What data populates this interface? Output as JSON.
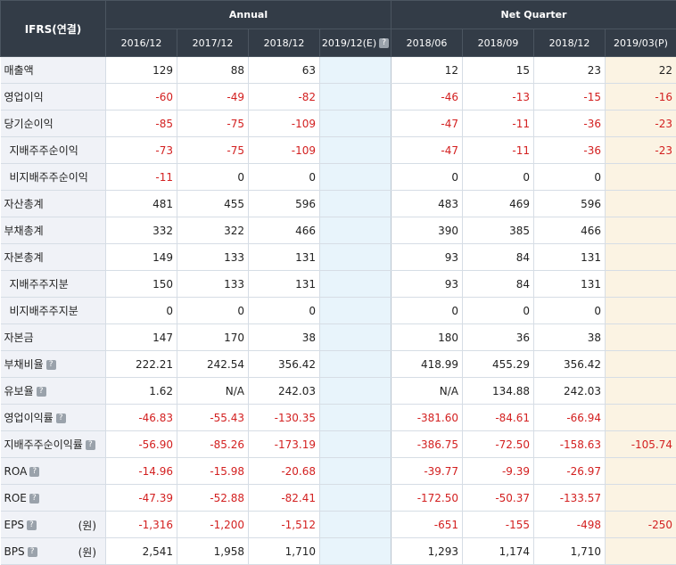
{
  "header": {
    "corner": "IFRS(연결)",
    "annual": "Annual",
    "quarter": "Net Quarter",
    "periods": [
      "2016/12",
      "2017/12",
      "2018/12",
      "2019/12(E)",
      "2018/06",
      "2018/09",
      "2018/12",
      "2019/03(P)"
    ]
  },
  "rows": [
    {
      "label": "매출액",
      "values": [
        "129",
        "88",
        "63",
        "",
        "12",
        "15",
        "23",
        "22"
      ]
    },
    {
      "label": "영업이익",
      "values": [
        "-60",
        "-49",
        "-82",
        "",
        "-46",
        "-13",
        "-15",
        "-16"
      ]
    },
    {
      "label": "당기순이익",
      "values": [
        "-85",
        "-75",
        "-109",
        "",
        "-47",
        "-11",
        "-36",
        "-23"
      ]
    },
    {
      "label": "지배주주순이익",
      "values": [
        "-73",
        "-75",
        "-109",
        "",
        "-47",
        "-11",
        "-36",
        "-23"
      ]
    },
    {
      "label": "비지배주주순이익",
      "values": [
        "-11",
        "0",
        "0",
        "",
        "0",
        "0",
        "0",
        ""
      ]
    },
    {
      "label": "자산총계",
      "values": [
        "481",
        "455",
        "596",
        "",
        "483",
        "469",
        "596",
        ""
      ]
    },
    {
      "label": "부채총계",
      "values": [
        "332",
        "322",
        "466",
        "",
        "390",
        "385",
        "466",
        ""
      ]
    },
    {
      "label": "자본총계",
      "values": [
        "149",
        "133",
        "131",
        "",
        "93",
        "84",
        "131",
        ""
      ]
    },
    {
      "label": "지배주주지분",
      "values": [
        "150",
        "133",
        "131",
        "",
        "93",
        "84",
        "131",
        ""
      ]
    },
    {
      "label": "비지배주주지분",
      "values": [
        "0",
        "0",
        "0",
        "",
        "0",
        "0",
        "0",
        ""
      ]
    },
    {
      "label": "자본금",
      "values": [
        "147",
        "170",
        "38",
        "",
        "180",
        "36",
        "38",
        ""
      ]
    },
    {
      "label": "부채비율",
      "values": [
        "222.21",
        "242.54",
        "356.42",
        "",
        "418.99",
        "455.29",
        "356.42",
        ""
      ]
    },
    {
      "label": "유보율",
      "values": [
        "1.62",
        "N/A",
        "242.03",
        "",
        "N/A",
        "134.88",
        "242.03",
        ""
      ]
    },
    {
      "label": "영업이익률",
      "values": [
        "-46.83",
        "-55.43",
        "-130.35",
        "",
        "-381.60",
        "-84.61",
        "-66.94",
        ""
      ]
    },
    {
      "label": "지배주주순이익률",
      "values": [
        "-56.90",
        "-85.26",
        "-173.19",
        "",
        "-386.75",
        "-72.50",
        "-158.63",
        "-105.74"
      ]
    },
    {
      "label": "ROA",
      "values": [
        "-14.96",
        "-15.98",
        "-20.68",
        "",
        "-39.77",
        "-9.39",
        "-26.97",
        ""
      ]
    },
    {
      "label": "ROE",
      "values": [
        "-47.39",
        "-52.88",
        "-82.41",
        "",
        "-172.50",
        "-50.37",
        "-133.57",
        ""
      ]
    },
    {
      "label": "EPS",
      "unit": "(원)",
      "values": [
        "-1,316",
        "-1,200",
        "-1,512",
        "",
        "-651",
        "-155",
        "-498",
        "-250"
      ]
    },
    {
      "label": "BPS",
      "unit": "(원)",
      "values": [
        "2,541",
        "1,958",
        "1,710",
        "",
        "1,293",
        "1,174",
        "1,710",
        ""
      ]
    }
  ],
  "help_icon_glyph": "?",
  "colors": {
    "negative": "#d32020",
    "header_bg": "#333c47",
    "estimate_bg": "#e8f4fb",
    "provisional_bg": "#fbf3e3"
  }
}
